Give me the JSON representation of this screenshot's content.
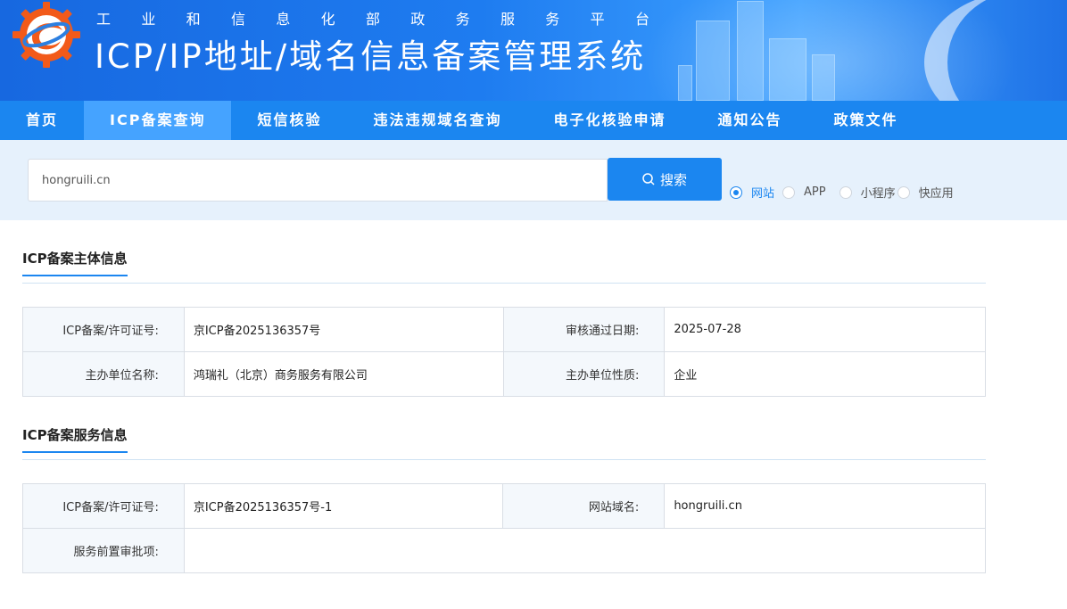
{
  "header": {
    "subtitle_chars": [
      "工",
      "业",
      "和",
      "信",
      "息",
      "化",
      "部",
      "政",
      "务",
      "服",
      "务",
      "平",
      "台"
    ],
    "title": "ICP/IP地址/域名信息备案管理系统"
  },
  "nav": {
    "items": [
      {
        "label": "首页",
        "active": false
      },
      {
        "label": "ICP备案查询",
        "active": true
      },
      {
        "label": "短信核验",
        "active": false
      },
      {
        "label": "违法违规域名查询",
        "active": false
      },
      {
        "label": "电子化核验申请",
        "active": false
      },
      {
        "label": "通知公告",
        "active": false
      },
      {
        "label": "政策文件",
        "active": false
      }
    ]
  },
  "search": {
    "value": "hongruili.cn",
    "button_label": "搜索",
    "types": [
      {
        "label": "网站",
        "checked": true
      },
      {
        "label": "APP",
        "checked": false
      },
      {
        "label": "小程序",
        "checked": false
      },
      {
        "label": "快应用",
        "checked": false
      }
    ]
  },
  "subject_section": {
    "title": "ICP备案主体信息",
    "rows": [
      {
        "k1": "ICP备案/许可证号:",
        "v1": "京ICP备2025136357号",
        "k2": "审核通过日期:",
        "v2": "2025-07-28"
      },
      {
        "k1": "主办单位名称:",
        "v1": "鸿瑞礼（北京）商务服务有限公司",
        "k2": "主办单位性质:",
        "v2": "企业"
      }
    ]
  },
  "service_section": {
    "title": "ICP备案服务信息",
    "row1": {
      "k1": "ICP备案/许可证号:",
      "v1": "京ICP备2025136357号-1",
      "k2": "网站域名:",
      "v2": "hongruili.cn"
    },
    "row2": {
      "k1": "服务前置审批项:",
      "v1": ""
    }
  },
  "colors": {
    "primary": "#1b86f0",
    "nav_active": "#45a3ff",
    "band": "#e6f1fc",
    "logo_orange": "#f25a1a"
  }
}
